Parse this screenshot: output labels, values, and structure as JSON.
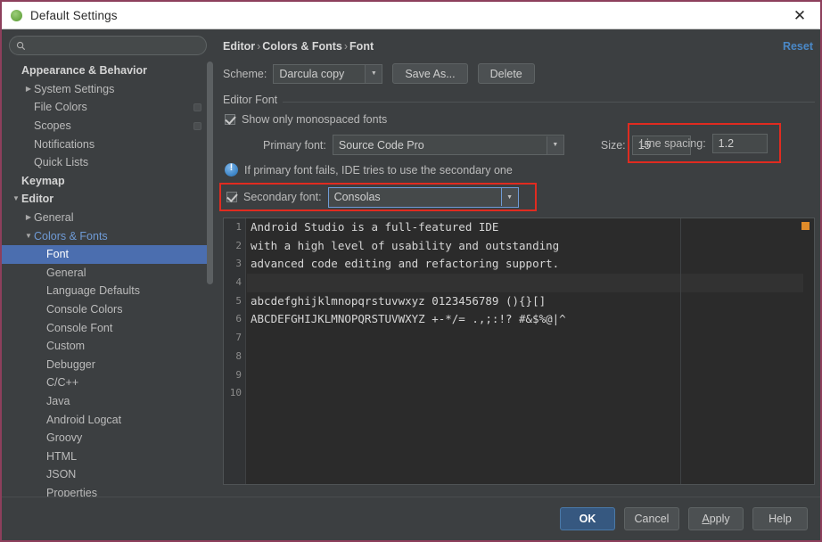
{
  "window": {
    "title": "Default Settings",
    "app_icon": "android-studio-icon",
    "close_icon": "close-icon"
  },
  "sidebar": {
    "search": {
      "value": "",
      "placeholder": "",
      "icon": "search-icon"
    },
    "items": [
      {
        "label": "Appearance & Behavior",
        "indent": 0,
        "bold": true,
        "arrow": "",
        "icon": false,
        "selected": false,
        "accent": false
      },
      {
        "label": "System Settings",
        "indent": 1,
        "bold": false,
        "arrow": "▶",
        "icon": false,
        "selected": false,
        "accent": false
      },
      {
        "label": "File Colors",
        "indent": 1,
        "bold": false,
        "arrow": "",
        "icon": true,
        "selected": false,
        "accent": false
      },
      {
        "label": "Scopes",
        "indent": 1,
        "bold": false,
        "arrow": "",
        "icon": true,
        "selected": false,
        "accent": false
      },
      {
        "label": "Notifications",
        "indent": 1,
        "bold": false,
        "arrow": "",
        "icon": false,
        "selected": false,
        "accent": false
      },
      {
        "label": "Quick Lists",
        "indent": 1,
        "bold": false,
        "arrow": "",
        "icon": false,
        "selected": false,
        "accent": false
      },
      {
        "label": "Keymap",
        "indent": 0,
        "bold": true,
        "arrow": "",
        "icon": false,
        "selected": false,
        "accent": false
      },
      {
        "label": "Editor",
        "indent": 0,
        "bold": true,
        "arrow": "▼",
        "icon": false,
        "selected": false,
        "accent": false
      },
      {
        "label": "General",
        "indent": 1,
        "bold": false,
        "arrow": "▶",
        "icon": false,
        "selected": false,
        "accent": false
      },
      {
        "label": "Colors & Fonts",
        "indent": 1,
        "bold": false,
        "arrow": "▼",
        "icon": false,
        "selected": false,
        "accent": true
      },
      {
        "label": "Font",
        "indent": 2,
        "bold": false,
        "arrow": "",
        "icon": false,
        "selected": true,
        "accent": false
      },
      {
        "label": "General",
        "indent": 2,
        "bold": false,
        "arrow": "",
        "icon": false,
        "selected": false,
        "accent": false
      },
      {
        "label": "Language Defaults",
        "indent": 2,
        "bold": false,
        "arrow": "",
        "icon": false,
        "selected": false,
        "accent": false
      },
      {
        "label": "Console Colors",
        "indent": 2,
        "bold": false,
        "arrow": "",
        "icon": false,
        "selected": false,
        "accent": false
      },
      {
        "label": "Console Font",
        "indent": 2,
        "bold": false,
        "arrow": "",
        "icon": false,
        "selected": false,
        "accent": false
      },
      {
        "label": "Custom",
        "indent": 2,
        "bold": false,
        "arrow": "",
        "icon": false,
        "selected": false,
        "accent": false
      },
      {
        "label": "Debugger",
        "indent": 2,
        "bold": false,
        "arrow": "",
        "icon": false,
        "selected": false,
        "accent": false
      },
      {
        "label": "C/C++",
        "indent": 2,
        "bold": false,
        "arrow": "",
        "icon": false,
        "selected": false,
        "accent": false
      },
      {
        "label": "Java",
        "indent": 2,
        "bold": false,
        "arrow": "",
        "icon": false,
        "selected": false,
        "accent": false
      },
      {
        "label": "Android Logcat",
        "indent": 2,
        "bold": false,
        "arrow": "",
        "icon": false,
        "selected": false,
        "accent": false
      },
      {
        "label": "Groovy",
        "indent": 2,
        "bold": false,
        "arrow": "",
        "icon": false,
        "selected": false,
        "accent": false
      },
      {
        "label": "HTML",
        "indent": 2,
        "bold": false,
        "arrow": "",
        "icon": false,
        "selected": false,
        "accent": false
      },
      {
        "label": "JSON",
        "indent": 2,
        "bold": false,
        "arrow": "",
        "icon": false,
        "selected": false,
        "accent": false
      },
      {
        "label": "Properties",
        "indent": 2,
        "bold": false,
        "arrow": "",
        "icon": false,
        "selected": false,
        "accent": false
      }
    ]
  },
  "main": {
    "breadcrumb": {
      "part1": "Editor",
      "part2": "Colors & Fonts",
      "part3": "Font",
      "separator": "›"
    },
    "reset_label": "Reset",
    "scheme": {
      "label": "Scheme:",
      "value": "Darcula copy",
      "save_as_label": "Save As...",
      "delete_label": "Delete"
    },
    "editor_font": {
      "group_title": "Editor Font",
      "show_monospaced_label": "Show only monospaced fonts",
      "show_monospaced_checked": true,
      "primary_font_label": "Primary font:",
      "primary_font_value": "Source Code Pro",
      "size_label": "Size:",
      "size_value": "15",
      "line_spacing_label": "Line spacing:",
      "line_spacing_value": "1.2",
      "hint_text": "If primary font fails, IDE tries to use the secondary one",
      "secondary_font_label": "Secondary font:",
      "secondary_font_value": "Consolas",
      "secondary_font_checked": true
    },
    "preview": {
      "line_numbers": [
        "1",
        "2",
        "3",
        "4",
        "5",
        "6",
        "7",
        "8",
        "9",
        "10"
      ],
      "lines": [
        "Android Studio is a full-featured IDE",
        "with a high level of usability and outstanding",
        "advanced code editing and refactoring support.",
        "",
        "abcdefghijklmnopqrstuvwxyz 0123456789 (){}[]",
        "ABCDEFGHIJKLMNOPQRSTUVWXYZ +-*/= .,;:!? #&$%@|^",
        "",
        "",
        "",
        ""
      ],
      "current_line_index": 3,
      "error_stripe_color": "#e08c2a"
    }
  },
  "footer": {
    "ok_label": "OK",
    "cancel_label": "Cancel",
    "apply_mnemonic": "A",
    "apply_rest": "pply",
    "help_label": "Help"
  },
  "colors": {
    "accent_blue": "#4b6eaf",
    "link_blue": "#4a88c7",
    "highlight_red": "#e02b20",
    "panel_bg": "#3c3f41",
    "editor_bg": "#2b2b2b",
    "window_border": "#8d3f5c"
  }
}
